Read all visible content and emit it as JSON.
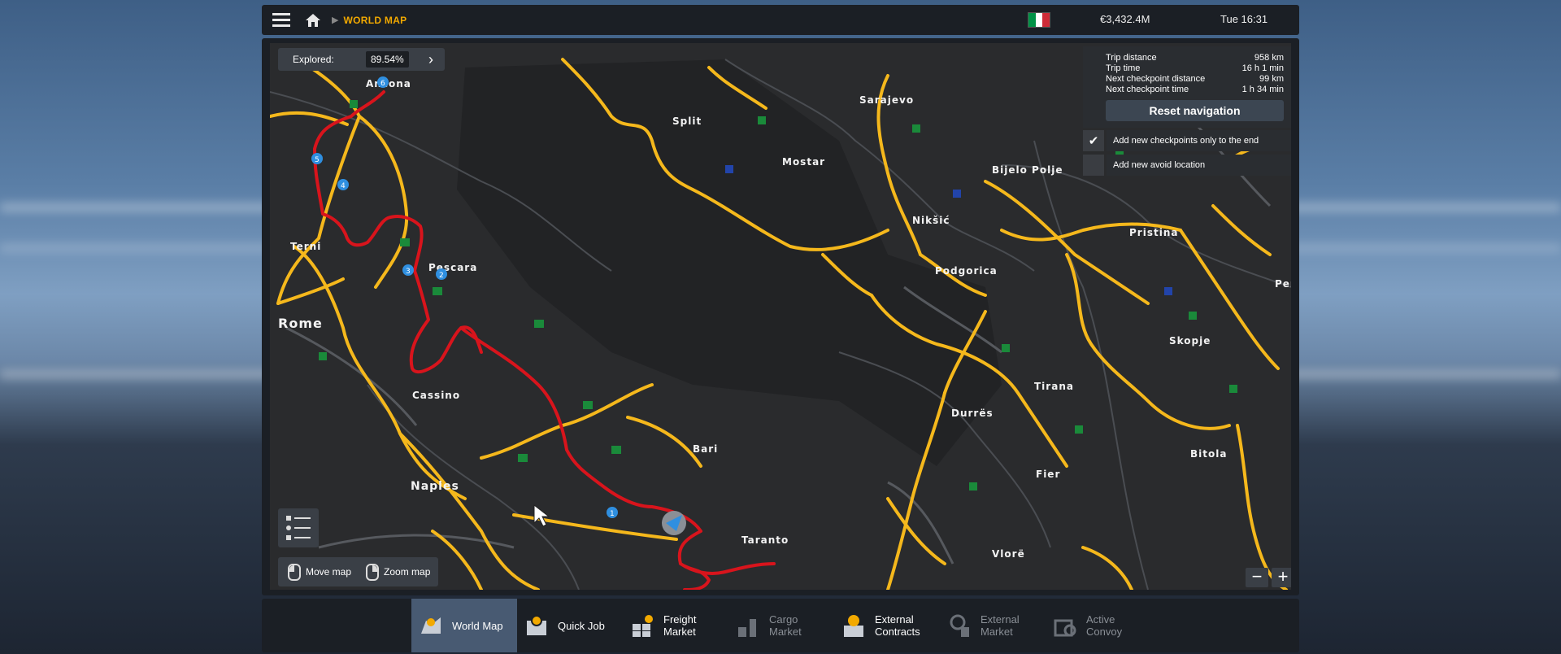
{
  "topbar": {
    "breadcrumb": "WORLD MAP",
    "money": "€3,432.4M",
    "time": "Tue 16:31",
    "flag_colors": [
      "#009246",
      "#ffffff",
      "#ce2b37"
    ]
  },
  "explored": {
    "label": "Explored:",
    "value": "89.54%"
  },
  "trip": {
    "rows": [
      {
        "label": "Trip distance",
        "value": "958 km"
      },
      {
        "label": "Trip time",
        "value": "16 h 1 min"
      },
      {
        "label": "Next checkpoint distance",
        "value": "99 km"
      },
      {
        "label": "Next checkpoint time",
        "value": "1 h 34 min"
      }
    ],
    "reset_label": "Reset navigation",
    "options": [
      {
        "label": "Add new checkpoints only to the end",
        "checked": true
      },
      {
        "label": "Add new avoid location",
        "checked": false
      }
    ]
  },
  "hints": {
    "move": "Move map",
    "zoom": "Zoom map"
  },
  "cities": {
    "ancona": "Ancona",
    "terni": "Terni",
    "pescara": "Pescara",
    "rome": "Rome",
    "cassino": "Cassino",
    "naples": "Naples",
    "bari": "Bari",
    "taranto": "Taranto",
    "split": "Split",
    "sarajevo": "Sarajevo",
    "mostar": "Mostar",
    "niksic": "Nikšić",
    "podgorica": "Podgorica",
    "bijelo_polje": "Bijelo Polje",
    "pristina": "Pristina",
    "skopje": "Skopje",
    "tirana": "Tirana",
    "durres": "Durrës",
    "fier": "Fier",
    "bitola": "Bitola",
    "vlore": "Vlorë",
    "per": "Per"
  },
  "waypoints": [
    "1",
    "2",
    "3",
    "4",
    "5",
    "6"
  ],
  "tabs": [
    {
      "label1": "World Map",
      "label2": "",
      "active": true,
      "dim": false
    },
    {
      "label1": "Quick Job",
      "label2": "",
      "active": false,
      "dim": false
    },
    {
      "label1": "Freight",
      "label2": "Market",
      "active": false,
      "dim": false
    },
    {
      "label1": "Cargo",
      "label2": "Market",
      "active": false,
      "dim": true
    },
    {
      "label1": "External",
      "label2": "Contracts",
      "active": false,
      "dim": false
    },
    {
      "label1": "External",
      "label2": "Market",
      "active": false,
      "dim": true
    },
    {
      "label1": "Active",
      "label2": "Convoy",
      "active": false,
      "dim": true
    }
  ],
  "colors": {
    "accent": "#f2a900",
    "route": "#d8141c",
    "road": "#f5b81c",
    "active_tab": "#485a72"
  }
}
